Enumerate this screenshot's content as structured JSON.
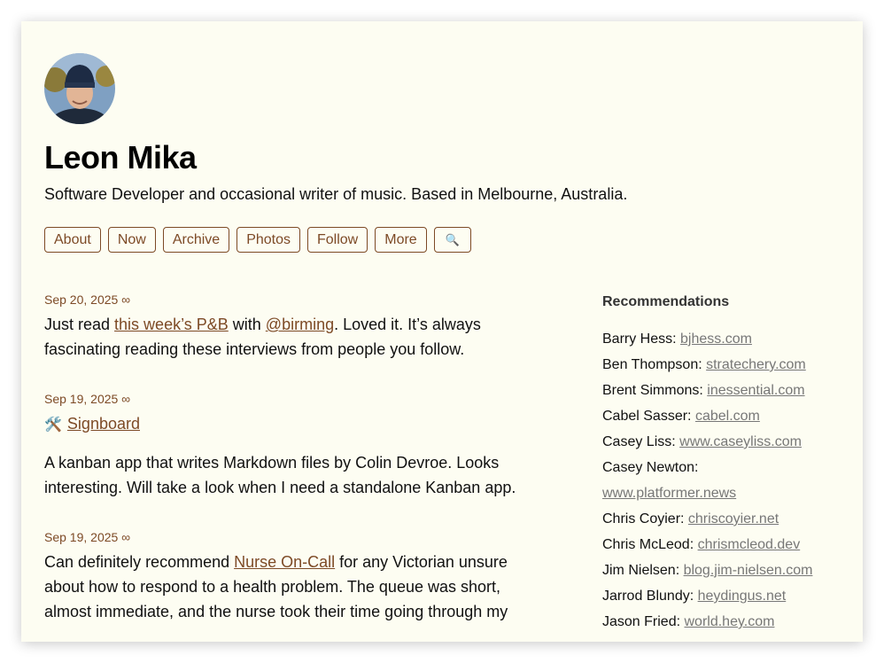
{
  "site": {
    "title": "Leon Mika",
    "tagline": "Software Developer and occasional writer of music. Based in Melbourne, Australia."
  },
  "nav": [
    {
      "label": "About"
    },
    {
      "label": "Now"
    },
    {
      "label": "Archive"
    },
    {
      "label": "Photos"
    },
    {
      "label": "Follow"
    },
    {
      "label": "More"
    }
  ],
  "search_icon": "🔍",
  "posts": [
    {
      "date": "Sep 20, 2025 ∞",
      "parts": [
        "Just read ",
        "this week’s P&B",
        " with ",
        "@birming",
        ". Loved it. It’s always fascinating reading these interviews from people you follow."
      ]
    },
    {
      "date": "Sep 19, 2025 ∞",
      "emoji": "🛠️",
      "title": "Signboard",
      "body": "A kanban app that writes Markdown files by Colin Devroe. Looks interesting. Will take a look when I need a standalone Kanban app."
    },
    {
      "date": "Sep 19, 2025 ∞",
      "parts": [
        "Can definitely recommend ",
        "Nurse On-Call",
        " for any Victorian unsure about how to respond to a health problem. The queue was short, almost immediate, and the nurse took their time going through my"
      ]
    }
  ],
  "sidebar": {
    "heading": "Recommendations",
    "items": [
      {
        "name": "Barry Hess: ",
        "link": "bjhess.com"
      },
      {
        "name": "Ben Thompson: ",
        "link": "stratechery.com"
      },
      {
        "name": "Brent Simmons: ",
        "link": "inessential.com"
      },
      {
        "name": "Cabel Sasser: ",
        "link": "cabel.com"
      },
      {
        "name": "Casey Liss: ",
        "link": "www.caseyliss.com"
      },
      {
        "name": "Casey Newton: ",
        "link": "www.platformer.news"
      },
      {
        "name": "Chris Coyier: ",
        "link": "chriscoyier.net"
      },
      {
        "name": "Chris McLeod: ",
        "link": "chrismcleod.dev"
      },
      {
        "name": "Jim Nielsen: ",
        "link": "blog.jim-nielsen.com"
      },
      {
        "name": "Jarrod Blundy: ",
        "link": "heydingus.net"
      },
      {
        "name": "Jason Fried: ",
        "link": "world.hey.com"
      }
    ]
  }
}
